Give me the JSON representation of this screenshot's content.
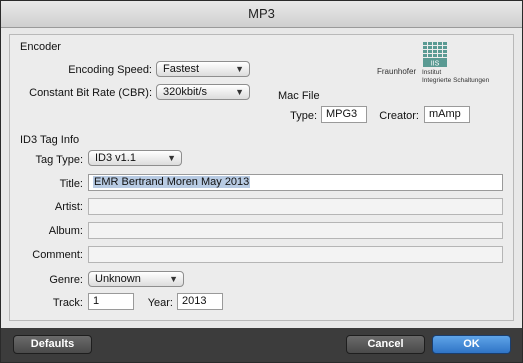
{
  "window": {
    "title": "MP3"
  },
  "encoder": {
    "section_label": "Encoder",
    "speed_label": "Encoding Speed:",
    "speed_value": "Fastest",
    "bitrate_label": "Constant Bit Rate (CBR):",
    "bitrate_value": "320kbit/s"
  },
  "logo": {
    "wordmark": "Fraunhofer",
    "line1": "Institut",
    "line2": "Integrierte Schaltungen",
    "badge": "IIS"
  },
  "mac_file": {
    "section_label": "Mac File",
    "type_label": "Type:",
    "type_value": "MPG3",
    "creator_label": "Creator:",
    "creator_value": "mAmp"
  },
  "id3": {
    "section_label": "ID3 Tag Info",
    "tag_type_label": "Tag Type:",
    "tag_type_value": "ID3 v1.1",
    "title_label": "Title:",
    "title_value": "EMR Bertrand Moren May 2013",
    "artist_label": "Artist:",
    "artist_value": "",
    "album_label": "Album:",
    "album_value": "",
    "comment_label": "Comment:",
    "comment_value": "",
    "genre_label": "Genre:",
    "genre_value": "Unknown",
    "track_label": "Track:",
    "track_value": "1",
    "year_label": "Year:",
    "year_value": "2013"
  },
  "buttons": {
    "defaults": "Defaults",
    "cancel": "Cancel",
    "ok": "OK"
  }
}
